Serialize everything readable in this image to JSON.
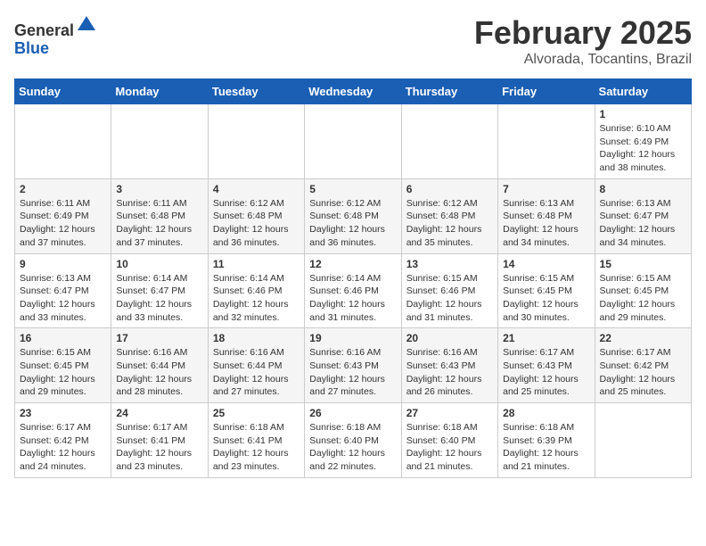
{
  "header": {
    "logo_general": "General",
    "logo_blue": "Blue",
    "month_title": "February 2025",
    "location": "Alvorada, Tocantins, Brazil"
  },
  "days_of_week": [
    "Sunday",
    "Monday",
    "Tuesday",
    "Wednesday",
    "Thursday",
    "Friday",
    "Saturday"
  ],
  "weeks": [
    [
      {
        "day": "",
        "info": ""
      },
      {
        "day": "",
        "info": ""
      },
      {
        "day": "",
        "info": ""
      },
      {
        "day": "",
        "info": ""
      },
      {
        "day": "",
        "info": ""
      },
      {
        "day": "",
        "info": ""
      },
      {
        "day": "1",
        "info": "Sunrise: 6:10 AM\nSunset: 6:49 PM\nDaylight: 12 hours and 38 minutes."
      }
    ],
    [
      {
        "day": "2",
        "info": "Sunrise: 6:11 AM\nSunset: 6:49 PM\nDaylight: 12 hours and 37 minutes."
      },
      {
        "day": "3",
        "info": "Sunrise: 6:11 AM\nSunset: 6:48 PM\nDaylight: 12 hours and 37 minutes."
      },
      {
        "day": "4",
        "info": "Sunrise: 6:12 AM\nSunset: 6:48 PM\nDaylight: 12 hours and 36 minutes."
      },
      {
        "day": "5",
        "info": "Sunrise: 6:12 AM\nSunset: 6:48 PM\nDaylight: 12 hours and 36 minutes."
      },
      {
        "day": "6",
        "info": "Sunrise: 6:12 AM\nSunset: 6:48 PM\nDaylight: 12 hours and 35 minutes."
      },
      {
        "day": "7",
        "info": "Sunrise: 6:13 AM\nSunset: 6:48 PM\nDaylight: 12 hours and 34 minutes."
      },
      {
        "day": "8",
        "info": "Sunrise: 6:13 AM\nSunset: 6:47 PM\nDaylight: 12 hours and 34 minutes."
      }
    ],
    [
      {
        "day": "9",
        "info": "Sunrise: 6:13 AM\nSunset: 6:47 PM\nDaylight: 12 hours and 33 minutes."
      },
      {
        "day": "10",
        "info": "Sunrise: 6:14 AM\nSunset: 6:47 PM\nDaylight: 12 hours and 33 minutes."
      },
      {
        "day": "11",
        "info": "Sunrise: 6:14 AM\nSunset: 6:46 PM\nDaylight: 12 hours and 32 minutes."
      },
      {
        "day": "12",
        "info": "Sunrise: 6:14 AM\nSunset: 6:46 PM\nDaylight: 12 hours and 31 minutes."
      },
      {
        "day": "13",
        "info": "Sunrise: 6:15 AM\nSunset: 6:46 PM\nDaylight: 12 hours and 31 minutes."
      },
      {
        "day": "14",
        "info": "Sunrise: 6:15 AM\nSunset: 6:45 PM\nDaylight: 12 hours and 30 minutes."
      },
      {
        "day": "15",
        "info": "Sunrise: 6:15 AM\nSunset: 6:45 PM\nDaylight: 12 hours and 29 minutes."
      }
    ],
    [
      {
        "day": "16",
        "info": "Sunrise: 6:15 AM\nSunset: 6:45 PM\nDaylight: 12 hours and 29 minutes."
      },
      {
        "day": "17",
        "info": "Sunrise: 6:16 AM\nSunset: 6:44 PM\nDaylight: 12 hours and 28 minutes."
      },
      {
        "day": "18",
        "info": "Sunrise: 6:16 AM\nSunset: 6:44 PM\nDaylight: 12 hours and 27 minutes."
      },
      {
        "day": "19",
        "info": "Sunrise: 6:16 AM\nSunset: 6:43 PM\nDaylight: 12 hours and 27 minutes."
      },
      {
        "day": "20",
        "info": "Sunrise: 6:16 AM\nSunset: 6:43 PM\nDaylight: 12 hours and 26 minutes."
      },
      {
        "day": "21",
        "info": "Sunrise: 6:17 AM\nSunset: 6:43 PM\nDaylight: 12 hours and 25 minutes."
      },
      {
        "day": "22",
        "info": "Sunrise: 6:17 AM\nSunset: 6:42 PM\nDaylight: 12 hours and 25 minutes."
      }
    ],
    [
      {
        "day": "23",
        "info": "Sunrise: 6:17 AM\nSunset: 6:42 PM\nDaylight: 12 hours and 24 minutes."
      },
      {
        "day": "24",
        "info": "Sunrise: 6:17 AM\nSunset: 6:41 PM\nDaylight: 12 hours and 23 minutes."
      },
      {
        "day": "25",
        "info": "Sunrise: 6:18 AM\nSunset: 6:41 PM\nDaylight: 12 hours and 23 minutes."
      },
      {
        "day": "26",
        "info": "Sunrise: 6:18 AM\nSunset: 6:40 PM\nDaylight: 12 hours and 22 minutes."
      },
      {
        "day": "27",
        "info": "Sunrise: 6:18 AM\nSunset: 6:40 PM\nDaylight: 12 hours and 21 minutes."
      },
      {
        "day": "28",
        "info": "Sunrise: 6:18 AM\nSunset: 6:39 PM\nDaylight: 12 hours and 21 minutes."
      },
      {
        "day": "",
        "info": ""
      }
    ]
  ]
}
